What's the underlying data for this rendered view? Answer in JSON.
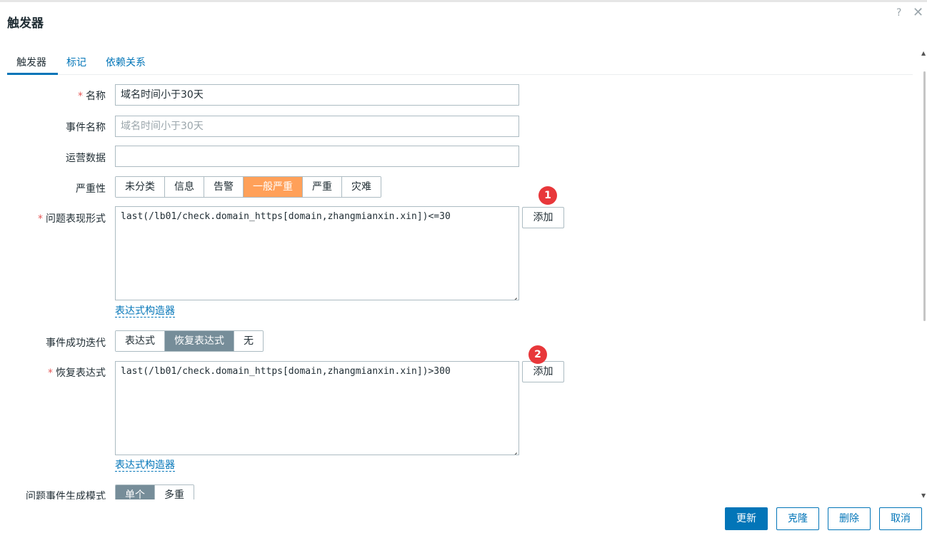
{
  "dialog": {
    "title": "触发器",
    "help_icon": "?",
    "close_icon": "✕"
  },
  "tabs": [
    {
      "label": "触发器",
      "active": true
    },
    {
      "label": "标记",
      "active": false
    },
    {
      "label": "依赖关系",
      "active": false
    }
  ],
  "form": {
    "name": {
      "label": "名称",
      "required": "*",
      "value": "域名时间小于30天"
    },
    "event_name": {
      "label": "事件名称",
      "placeholder": "域名时间小于30天"
    },
    "opdata": {
      "label": "运营数据",
      "value": ""
    },
    "severity": {
      "label": "严重性",
      "options": [
        "未分类",
        "信息",
        "告警",
        "一般严重",
        "严重",
        "灾难"
      ],
      "selected": "一般严重"
    },
    "problem_expression": {
      "label": "问题表现形式",
      "required": "*",
      "value": "last(/lb01/check.domain_https[domain,zhangmianxin.xin])<=30",
      "add_label": "添加",
      "badge": "1",
      "builder_link": "表达式构造器"
    },
    "ok_event_generation": {
      "label": "事件成功迭代",
      "options": [
        "表达式",
        "恢复表达式",
        "无"
      ],
      "selected": "恢复表达式"
    },
    "recovery_expression": {
      "label": "恢复表达式",
      "required": "*",
      "value": "last(/lb01/check.domain_https[domain,zhangmianxin.xin])>300",
      "add_label": "添加",
      "badge": "2",
      "builder_link": "表达式构造器"
    },
    "problem_event_mode": {
      "label": "问题事件生成模式",
      "options": [
        "单个",
        "多重"
      ],
      "selected": "单个"
    }
  },
  "footer": {
    "update": "更新",
    "clone": "克隆",
    "delete": "删除",
    "cancel": "取消"
  },
  "colors": {
    "accent": "#0275b8",
    "severity_average": "#ffa059",
    "selected_gray": "#768d99",
    "required": "#e45959",
    "badge": "#e8373a"
  }
}
